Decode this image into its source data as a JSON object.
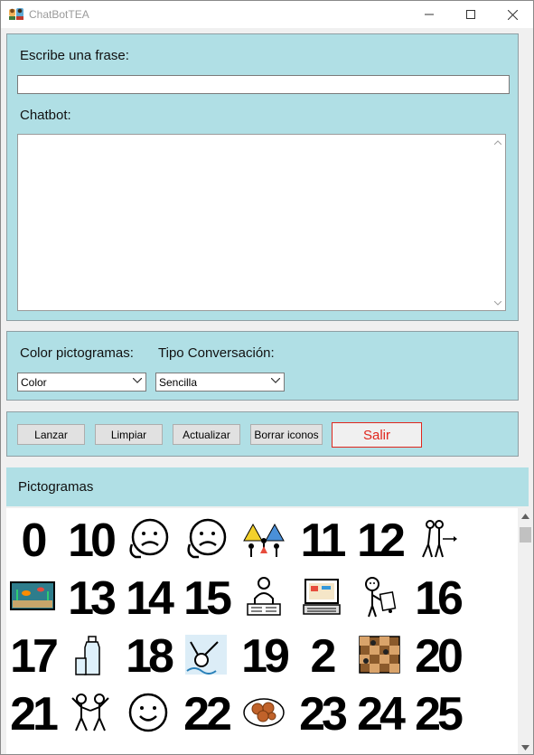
{
  "window": {
    "title": "ChatBotTEA",
    "controls": [
      "minimize-icon",
      "maximize-icon",
      "close-icon"
    ]
  },
  "input_section": {
    "phrase_label": "Escribe una frase:",
    "phrase_value": "",
    "chatbot_label": "Chatbot:",
    "chatbot_value": ""
  },
  "options_section": {
    "color_label": "Color pictogramas:",
    "color_selected": "Color",
    "type_label": "Tipo Conversación:",
    "type_selected": "Sencilla"
  },
  "buttons": {
    "launch": "Lanzar",
    "clear": "Limpiar",
    "update": "Actualizar",
    "delete_icons": "Borrar iconos",
    "exit": "Salir"
  },
  "pictograms": {
    "header": "Pictogramas",
    "rows": [
      [
        {
          "kind": "number",
          "text": "0"
        },
        {
          "kind": "number",
          "text": "10"
        },
        {
          "kind": "icon",
          "icon": "sad-face-icon"
        },
        {
          "kind": "icon",
          "icon": "sad-face-icon"
        },
        {
          "kind": "icon",
          "icon": "camping-group-icon"
        },
        {
          "kind": "number",
          "text": "11"
        },
        {
          "kind": "number",
          "text": "12"
        },
        {
          "kind": "icon",
          "icon": "walking-people-icon"
        }
      ],
      [
        {
          "kind": "icon",
          "icon": "aquarium-icon"
        },
        {
          "kind": "number",
          "text": "13"
        },
        {
          "kind": "number",
          "text": "14"
        },
        {
          "kind": "number",
          "text": "15"
        },
        {
          "kind": "icon",
          "icon": "person-reading-icon"
        },
        {
          "kind": "icon",
          "icon": "computer-icon"
        },
        {
          "kind": "icon",
          "icon": "person-thinking-icon"
        },
        {
          "kind": "number",
          "text": "16"
        }
      ],
      [
        {
          "kind": "number",
          "text": "17"
        },
        {
          "kind": "icon",
          "icon": "water-bottle-glass-icon"
        },
        {
          "kind": "number",
          "text": "18"
        },
        {
          "kind": "icon",
          "icon": "person-swimming-icon"
        },
        {
          "kind": "number",
          "text": "19"
        },
        {
          "kind": "number",
          "text": "2"
        },
        {
          "kind": "icon",
          "icon": "chess-board-icon"
        },
        {
          "kind": "number",
          "text": "20"
        }
      ],
      [
        {
          "kind": "number",
          "text": "21"
        },
        {
          "kind": "icon",
          "icon": "people-dancing-icon"
        },
        {
          "kind": "icon",
          "icon": "happy-face-icon"
        },
        {
          "kind": "number",
          "text": "22"
        },
        {
          "kind": "icon",
          "icon": "food-plate-icon"
        },
        {
          "kind": "number",
          "text": "23"
        },
        {
          "kind": "number",
          "text": "24"
        },
        {
          "kind": "number",
          "text": "25"
        }
      ]
    ]
  },
  "colors": {
    "panel": "#b0dfe5",
    "exit_border": "#e0261d"
  }
}
